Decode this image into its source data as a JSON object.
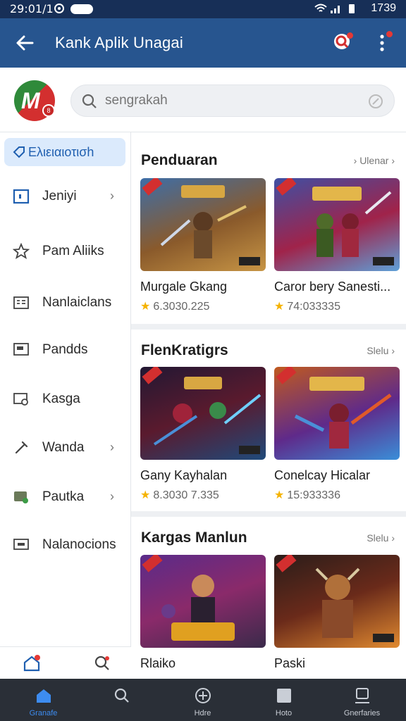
{
  "status_bar": {
    "time": "29:01/1",
    "clock": "1739"
  },
  "app_bar": {
    "title": "Kank Aplik Unagai"
  },
  "header": {
    "logo_letter": "M",
    "logo_badge": "8",
    "search_placeholder": "sengrakah"
  },
  "sidebar": {
    "active_item": {
      "label": "Ελιειαιοτισh",
      "icon": "tag-icon"
    },
    "items": [
      {
        "label": "Jeniyi",
        "icon": "calendar-icon",
        "chevron": true
      },
      {
        "label": "Pam Aliiks",
        "icon": "star-outline-icon",
        "chevron": false
      },
      {
        "label": "Nanlaiclans",
        "icon": "grid-card-icon",
        "chevron": false
      },
      {
        "label": "Pandds",
        "icon": "screen-icon",
        "chevron": false
      },
      {
        "label": "Kasga",
        "icon": "window-search-icon",
        "chevron": false
      },
      {
        "label": "Wanda",
        "icon": "pin-icon",
        "chevron": true
      },
      {
        "label": "Pautka",
        "icon": "chat-icon",
        "chevron": true
      },
      {
        "label": "Nalanocions",
        "icon": "monitor-icon",
        "chevron": false
      }
    ]
  },
  "sections": [
    {
      "title": "Penduaran",
      "more": "› Ulenar ›",
      "cards": [
        {
          "name": "Murgale Gkang",
          "rating": "6.3030.225",
          "colors": [
            "#3d6ea8",
            "#8a5a2b",
            "#c79545"
          ]
        },
        {
          "name": "Caror bery Sanesti...",
          "rating": "74:033335",
          "colors": [
            "#3f4fa3",
            "#a0234a",
            "#5ea0d8"
          ]
        }
      ]
    },
    {
      "title": "FlenKratigrs",
      "more": "Slelu ›",
      "cards": [
        {
          "name": "Gany Kayhalan",
          "rating": "8.3030 7.335",
          "colors": [
            "#221833",
            "#a0233a",
            "#4a8fd8"
          ]
        },
        {
          "name": "Conelcay Hicalar",
          "rating": "15:933336",
          "colors": [
            "#c05a1f",
            "#5f2a8a",
            "#3a8ed8"
          ]
        }
      ]
    },
    {
      "title": "Kargas Manlun",
      "more": "Slelu ›",
      "cards": [
        {
          "name": "Rlaiko",
          "rating": "",
          "colors": [
            "#5a2b8a",
            "#e0a020",
            "#3a2a4a"
          ]
        },
        {
          "name": "Paski",
          "rating": "",
          "colors": [
            "#2a1d1a",
            "#b0501f",
            "#e08a30"
          ]
        }
      ]
    }
  ],
  "bottom_nav": [
    {
      "label": "Granafe",
      "icon": "home-icon",
      "active": true
    },
    {
      "label": "",
      "icon": "search-icon",
      "active": false
    },
    {
      "label": "Hdre",
      "icon": "compass-icon",
      "active": false
    },
    {
      "label": "Hoto",
      "icon": "square-icon",
      "active": false
    },
    {
      "label": "Gnerfaries",
      "icon": "profile-icon",
      "active": false
    }
  ]
}
